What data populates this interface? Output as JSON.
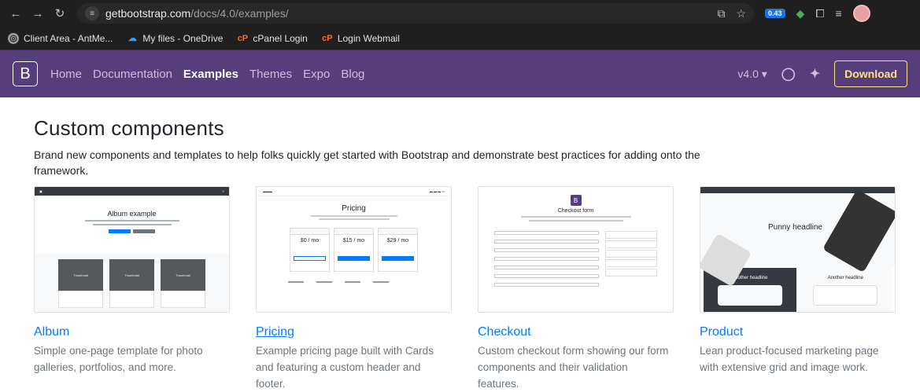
{
  "browser": {
    "url_host": "getbootstrap.com",
    "url_path": "/docs/4.0/examples/",
    "extension_badge": "0.43"
  },
  "bookmarks": [
    {
      "label": "Client Area - AntMe...",
      "icon": "globe-icon"
    },
    {
      "label": "My files - OneDrive",
      "icon": "onedrive-cloud-icon"
    },
    {
      "label": "cPanel Login",
      "icon": "cpanel-icon"
    },
    {
      "label": "Login Webmail",
      "icon": "cpanel-icon"
    }
  ],
  "navbar": {
    "brand": "B",
    "links": [
      "Home",
      "Documentation",
      "Examples",
      "Themes",
      "Expo",
      "Blog"
    ],
    "active": "Examples",
    "version": "v4.0",
    "download": "Download",
    "colors": {
      "navbar_bg": "#563d7c",
      "download_accent": "#ffe484"
    }
  },
  "section": {
    "title": "Custom components",
    "description": "Brand new components and templates to help folks quickly get started with Bootstrap and demonstrate best practices for adding onto the framework."
  },
  "cards": [
    {
      "title": "Album",
      "description": "Simple one-page template for photo galleries, portfolios, and more.",
      "thumb_heading": "Album example",
      "thumb_tile": "Thumbnail"
    },
    {
      "title": "Pricing",
      "description": "Example pricing page built with Cards and featuring a custom header and footer.",
      "thumb_heading": "Pricing",
      "prices": [
        "$0 / mo",
        "$15 / mo",
        "$29 / mo"
      ]
    },
    {
      "title": "Checkout",
      "description": "Custom checkout form showing our form components and their validation features.",
      "thumb_heading": "Checkout form"
    },
    {
      "title": "Product",
      "description": "Lean product-focused marketing page with extensive grid and image work.",
      "thumb_heading": "Punny headline",
      "thumb_sub": "Another headline"
    }
  ],
  "link_color": "#007bff"
}
